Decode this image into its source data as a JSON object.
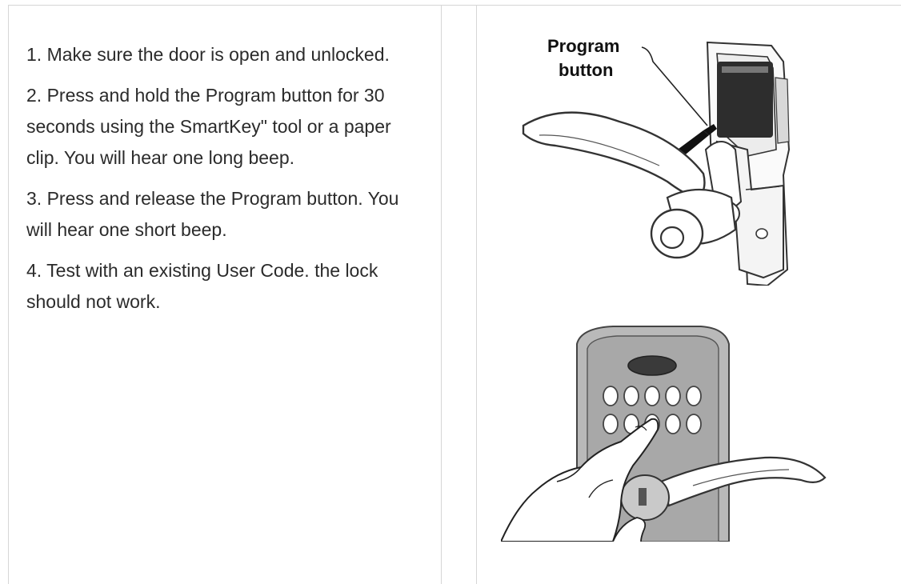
{
  "steps": [
    "1. Make sure the door is open and unlocked.",
    "2. Press and hold the Program button for 30 seconds using the SmartKey\" tool or a paper clip. You will hear one long beep.",
    "3. Press and release the Program button. You will hear one short beep.",
    "4. Test with an existing User Code. the lock should not work."
  ],
  "figure1": {
    "label_line1": "Program",
    "label_line2": "button",
    "icon": "lever-lock-program-button-illustration"
  },
  "figure2": {
    "icon": "keypad-lock-hand-entry-illustration"
  }
}
